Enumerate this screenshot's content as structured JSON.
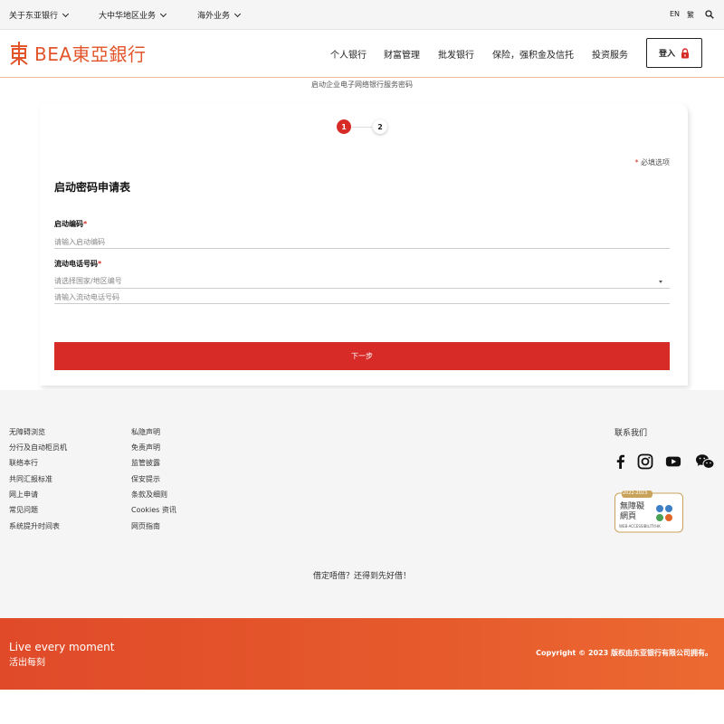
{
  "topbar": {
    "about": "关于东亚银行",
    "greater_china": "大中华地区业务",
    "overseas": "海外业务",
    "lang_en": "EN",
    "lang_tc": "繁"
  },
  "header": {
    "logo_text": "BEA東亞銀行",
    "nav": [
      "个人银行",
      "财富管理",
      "批发银行",
      "保险，强积金及信托",
      "投资服务"
    ],
    "login_label": "登入"
  },
  "page_subtitle": "启动企业电子网络银行服务密码",
  "form": {
    "steps": [
      "1",
      "2"
    ],
    "active_step": 1,
    "required_note": "必填选项",
    "required_star": "*",
    "title": "启动密码申请表",
    "activation_code_label": "启动编码",
    "activation_code_placeholder": "请输入启动编码",
    "mobile_label": "流动电话号码",
    "country_placeholder": "请选择国家/地区编号",
    "mobile_placeholder": "请输入流动电话号码",
    "next_label": "下一步"
  },
  "footer": {
    "col1": [
      "无障碍浏览",
      "分行及自动柜员机",
      "联络本行",
      "共同汇报标准",
      "网上申请",
      "常见问题",
      "系统提升时间表"
    ],
    "col2": [
      "私隐声明",
      "免责声明",
      "监管披露",
      "保安提示",
      "条款及细则",
      "Cookies 资讯",
      "网页指南"
    ],
    "contact_title": "联系我们",
    "social": [
      "facebook-icon",
      "instagram-icon",
      "youtube-icon",
      "wechat-icon"
    ],
    "badge_title": "無障礙網頁",
    "badge_years": "2022-2023",
    "badge_url": "WEB-ACCESSIBILITY.HK",
    "slogan": "借定唔借？还得到先好借！"
  },
  "bottom": {
    "tagline_en": "Live every moment",
    "tagline_cn": "活出每刻",
    "copyright": "Copyright © 2023 版权由东亚银行有限公司拥有。"
  },
  "colors": {
    "brand_orange": "#e2552a",
    "brand_red": "#d62b27"
  }
}
